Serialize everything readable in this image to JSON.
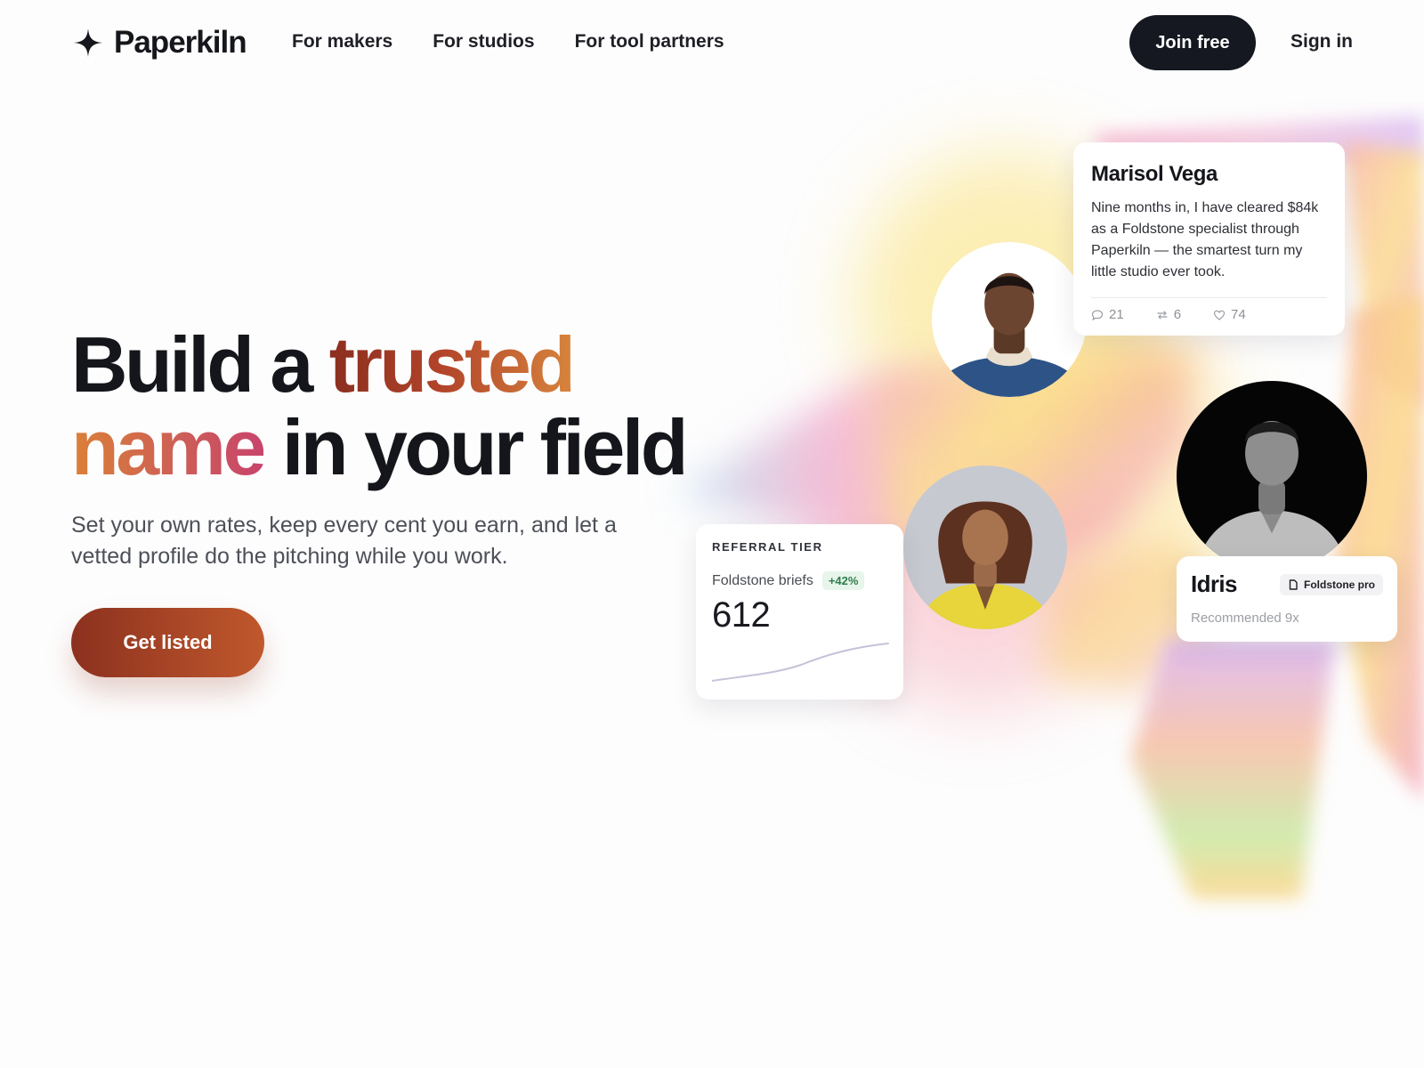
{
  "brand": {
    "name": "Paperkiln",
    "icon": "sparkle-star-icon"
  },
  "nav": {
    "items": [
      {
        "label": "For makers"
      },
      {
        "label": "For studios"
      },
      {
        "label": "For tool partners"
      }
    ],
    "join_label": "Join free",
    "signin_label": "Sign in"
  },
  "hero": {
    "title_1": "Build a ",
    "title_highlight_1": "trusted",
    "title_highlight_2": "name",
    "title_2": " in your field",
    "subtitle": "Set your own rates, keep every cent you earn, and let a vetted profile do the pitching while you work.",
    "cta_label": "Get listed"
  },
  "testimonial": {
    "name": "Marisol Vega",
    "quote": "Nine months in, I have cleared $84k as a Foldstone specialist through Paperkiln — the smartest turn my little studio ever took.",
    "stats": {
      "comments": "21",
      "reposts": "6",
      "likes": "74"
    },
    "icons": [
      "comment-icon",
      "repost-icon",
      "heart-icon"
    ]
  },
  "referral": {
    "title": "REFERRAL TIER",
    "label": "Foldstone briefs",
    "change": "+42%",
    "value": "612"
  },
  "profile": {
    "name": "Idris",
    "badge": "Foldstone pro",
    "badge_icon": "document-icon",
    "subtitle": "Recommended 9x"
  },
  "colors": {
    "primary_dark": "#151820",
    "cta_start": "#8c311f",
    "cta_end": "#c0582c",
    "accent_trusted": "#a93d28",
    "accent_name": "#d9773f",
    "positive": "#2f7d4d"
  }
}
